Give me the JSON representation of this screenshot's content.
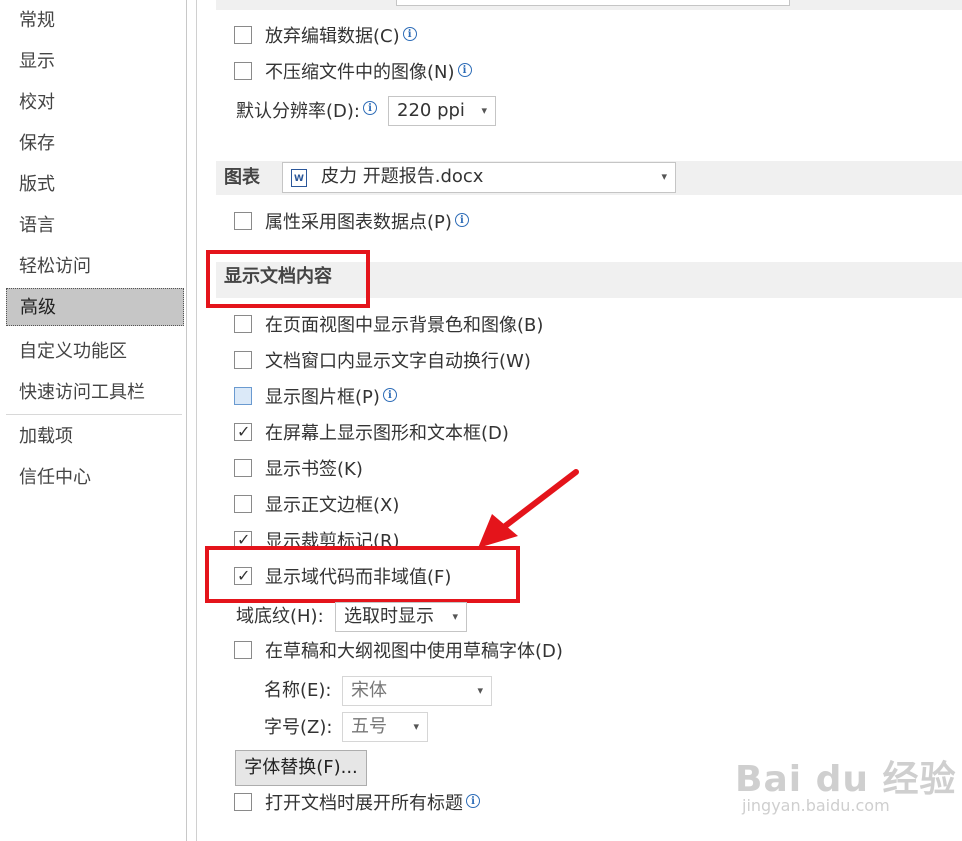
{
  "sidebar": {
    "items": [
      "常规",
      "显示",
      "校对",
      "保存",
      "版式",
      "语言",
      "轻松访问",
      "高级",
      "自定义功能区",
      "快速访问工具栏",
      "加载项",
      "信任中心"
    ],
    "active": "高级"
  },
  "image_section": {
    "discard_edit": "放弃编辑数据(C)",
    "no_compress": "不压缩文件中的图像(N)",
    "resolution_label": "默认分辨率(D):",
    "resolution_value": "220 ppi"
  },
  "chart_section": {
    "title": "图表",
    "doc_value": "皮力 开题报告.docx",
    "use_chart_points": "属性采用图表数据点(P)"
  },
  "display_section": {
    "title": "显示文档内容",
    "options": [
      {
        "label": "在页面视图中显示背景色和图像(B)",
        "checked": false
      },
      {
        "label": "文档窗口内显示文字自动换行(W)",
        "checked": false
      },
      {
        "label": "显示图片框(P)",
        "checked": false
      },
      {
        "label": "在屏幕上显示图形和文本框(D)",
        "checked": true
      },
      {
        "label": "显示书签(K)",
        "checked": false
      },
      {
        "label": "显示正文边框(X)",
        "checked": false
      },
      {
        "label": "显示裁剪标记(R)",
        "checked": true
      },
      {
        "label": "显示域代码而非域值(F)",
        "checked": true
      }
    ],
    "field_shading_label": "域底纹(H):",
    "field_shading_value": "选取时显示",
    "draft_font_option": "在草稿和大纲视图中使用草稿字体(D)",
    "name_label": "名称(E):",
    "name_value": "宋体",
    "size_label": "字号(Z):",
    "size_value": "五号",
    "font_substitute_button": "字体替换(F)...",
    "expand_headings": "打开文档时展开所有标题"
  },
  "icons": {
    "info": "i",
    "check": "✓",
    "dropdown": "▾",
    "word_doc": "W"
  },
  "watermark": {
    "brand": "Bai du 经验",
    "url": "jingyan.baidu.com"
  },
  "colors": {
    "annotation_red": "#e4141b",
    "selected_nav": "#c6c6c6"
  }
}
